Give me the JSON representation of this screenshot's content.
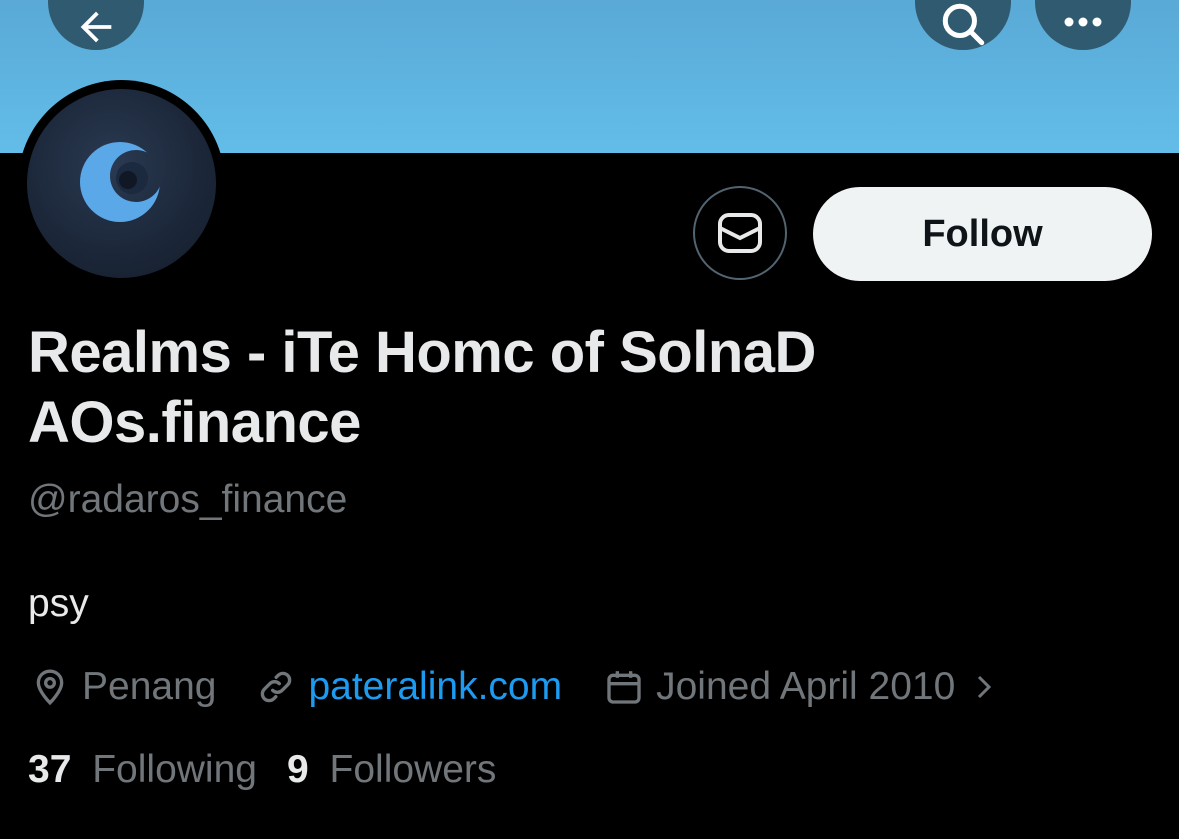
{
  "profile": {
    "display_name_line1": "Realms - iTe Homc of SolnaD",
    "display_name_line2": "AOs.finance",
    "handle": "@radaros_finance",
    "bio": "psy",
    "location": "Penang",
    "website": "pateralink.com",
    "joined": "Joined April 2010",
    "following_count": "37",
    "following_label": "Following",
    "followers_count": "9",
    "followers_label": "Followers"
  },
  "actions": {
    "follow_label": "Follow"
  },
  "colors": {
    "banner": "#5fb6e4",
    "background": "#000000",
    "primary_text": "#e7e9ea",
    "secondary_text": "#71767b",
    "link": "#1d9bf0",
    "follow_button_bg": "#eff3f4"
  },
  "icons": {
    "back": "arrow-left-icon",
    "search": "search-icon",
    "more": "more-icon",
    "message": "message-icon",
    "location": "location-pin-icon",
    "link": "link-icon",
    "calendar": "calendar-icon",
    "chevron": "chevron-right-icon"
  }
}
